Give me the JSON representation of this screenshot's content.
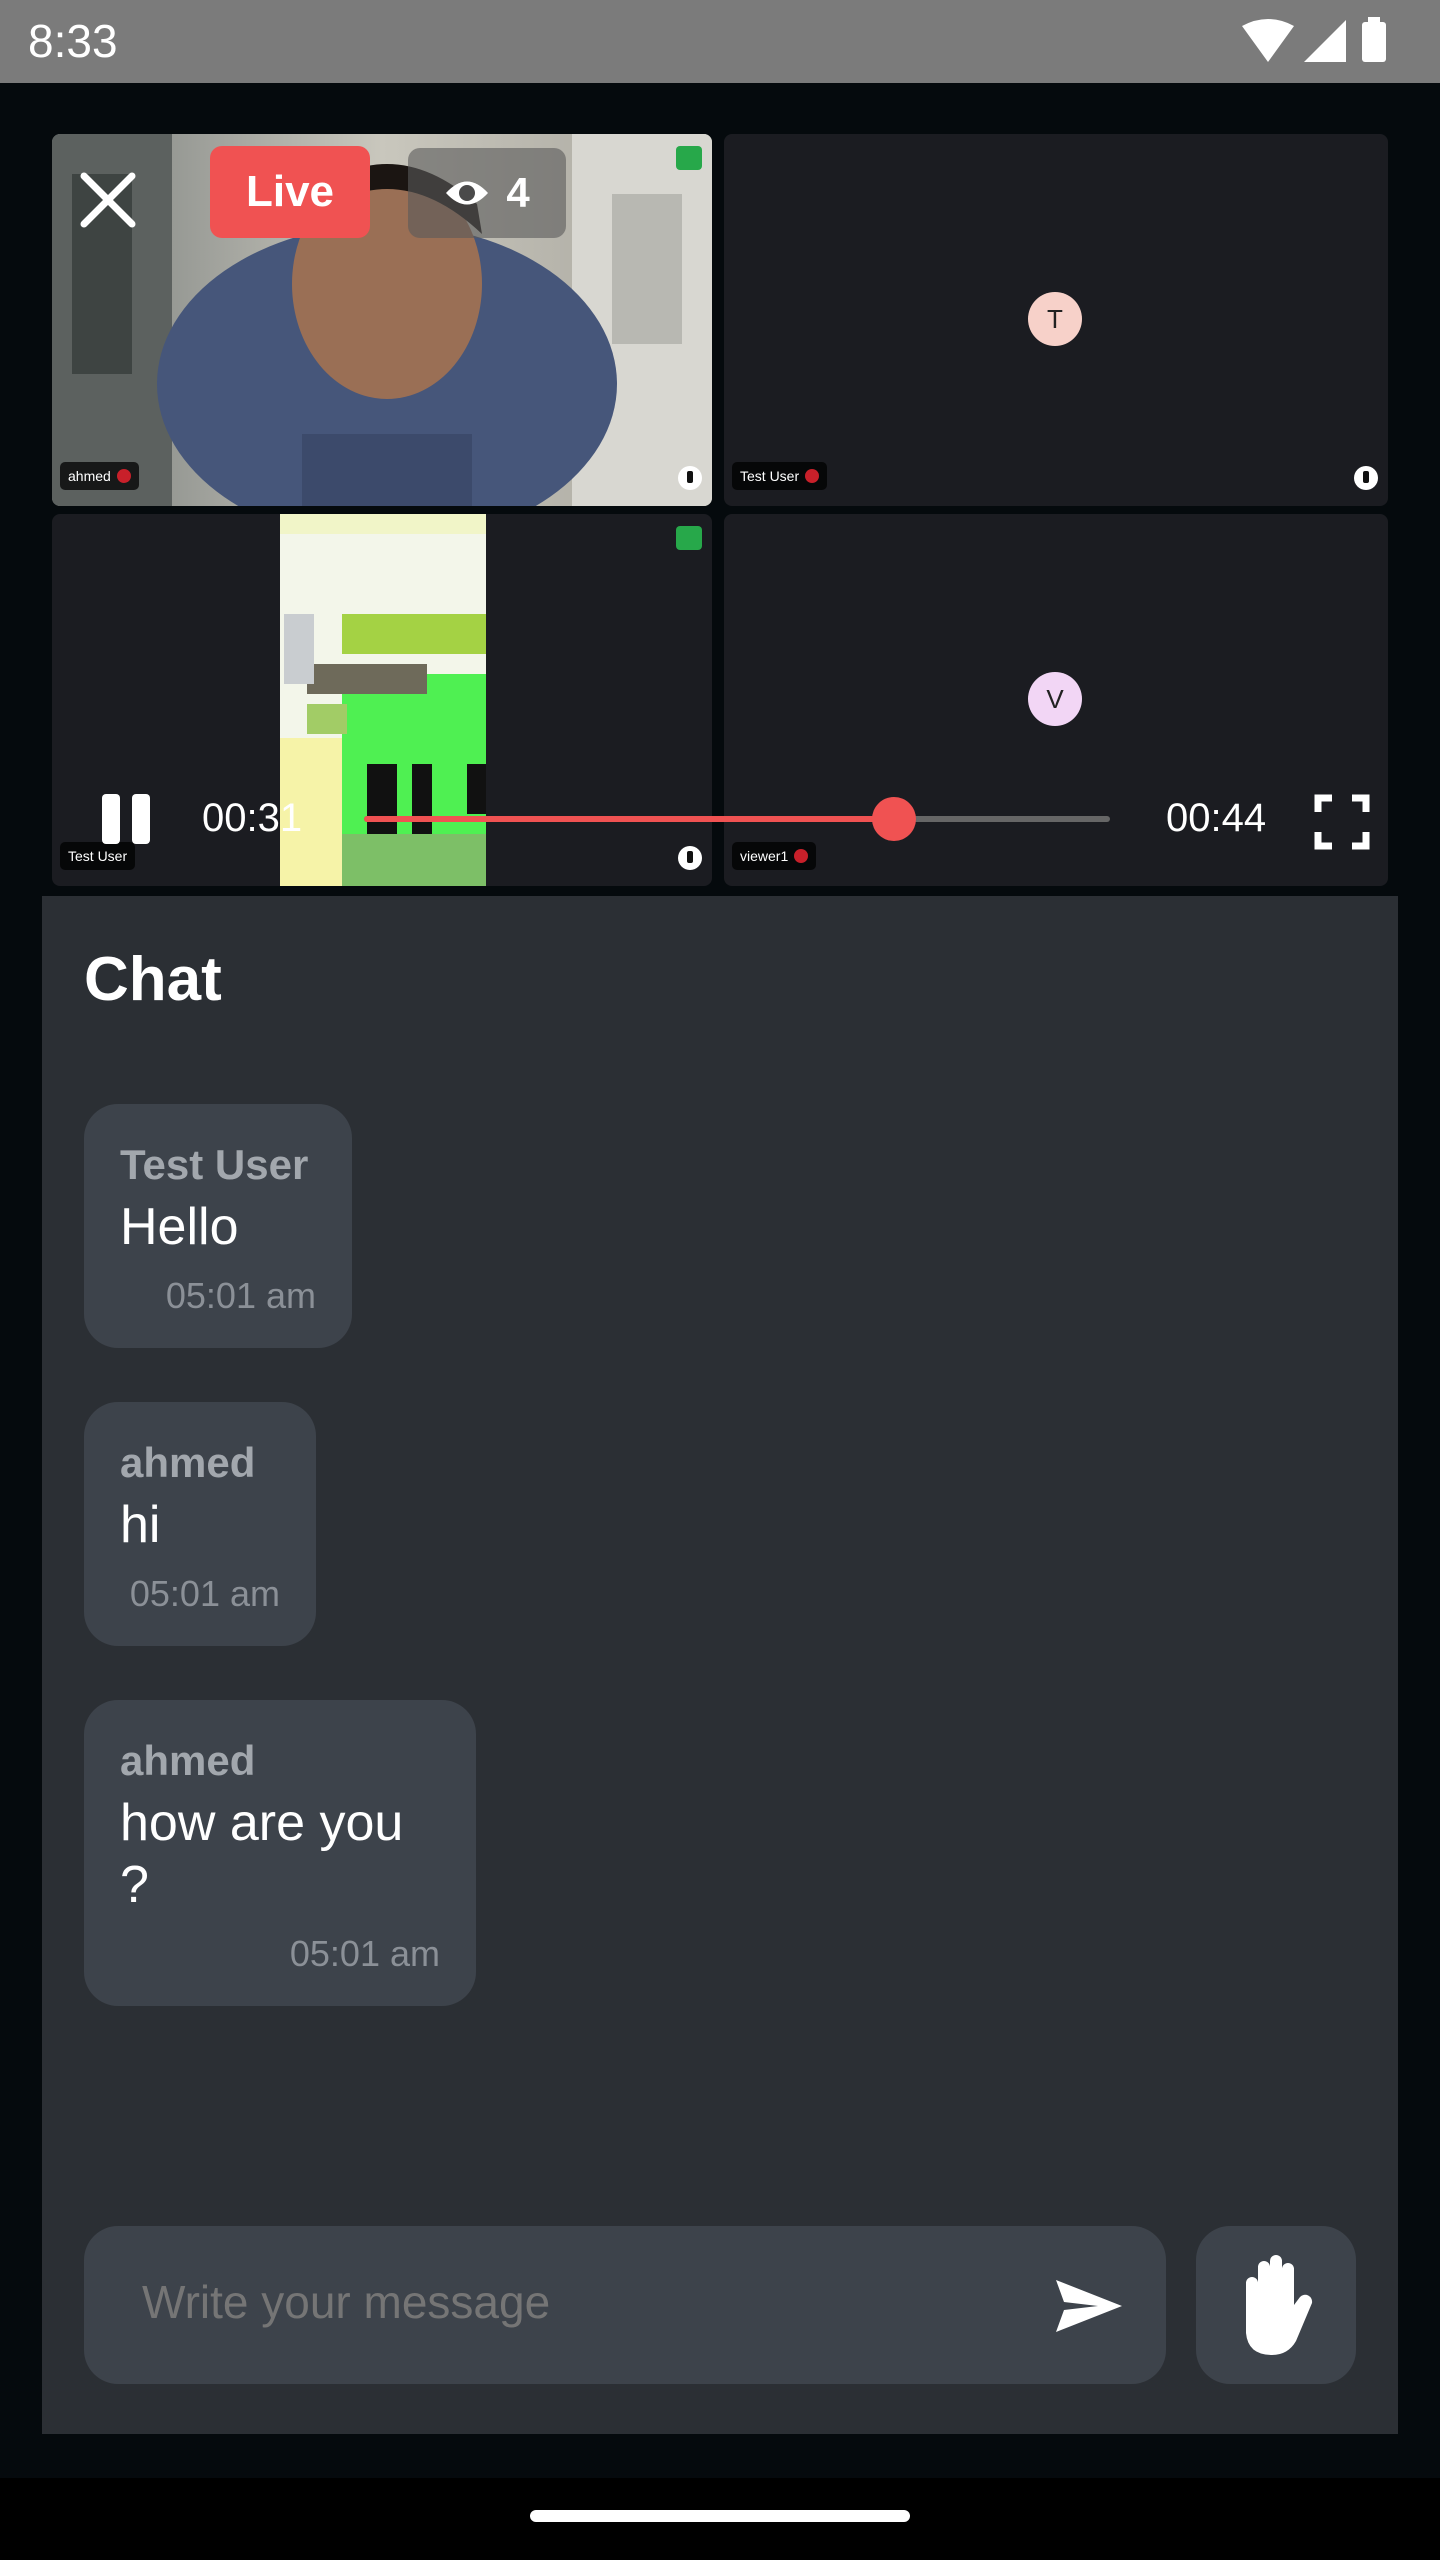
{
  "status_bar": {
    "time": "8:33"
  },
  "live_overlay": {
    "live_label": "Live",
    "viewer_count": "4"
  },
  "participants": [
    {
      "name": "ahmed"
    },
    {
      "name": "Test User",
      "initial": "T",
      "avatar_color": "#f7d1c9"
    },
    {
      "name": "Test User"
    },
    {
      "name": "viewer1",
      "initial": "V",
      "avatar_color": "#f2d6f5"
    }
  ],
  "player": {
    "current_time": "00:31",
    "total_time": "00:44",
    "progress": 0.71
  },
  "chat": {
    "title": "Chat",
    "messages": [
      {
        "sender": "Test User",
        "text": "Hello",
        "time": "05:01 am"
      },
      {
        "sender": "ahmed",
        "text": "hi",
        "time": "05:01 am"
      },
      {
        "sender": "ahmed",
        "text": "how are you ?",
        "time": "05:01 am"
      }
    ],
    "input_placeholder": "Write your message"
  },
  "colors": {
    "accent": "#f05252",
    "panel": "#2b2f34",
    "bubble": "#3d434b"
  },
  "icons": [
    "close-icon",
    "eye-icon",
    "signal-icon",
    "pin-icon",
    "mic-off-icon",
    "pause-icon",
    "fullscreen-icon",
    "send-icon",
    "raise-hand-icon"
  ]
}
